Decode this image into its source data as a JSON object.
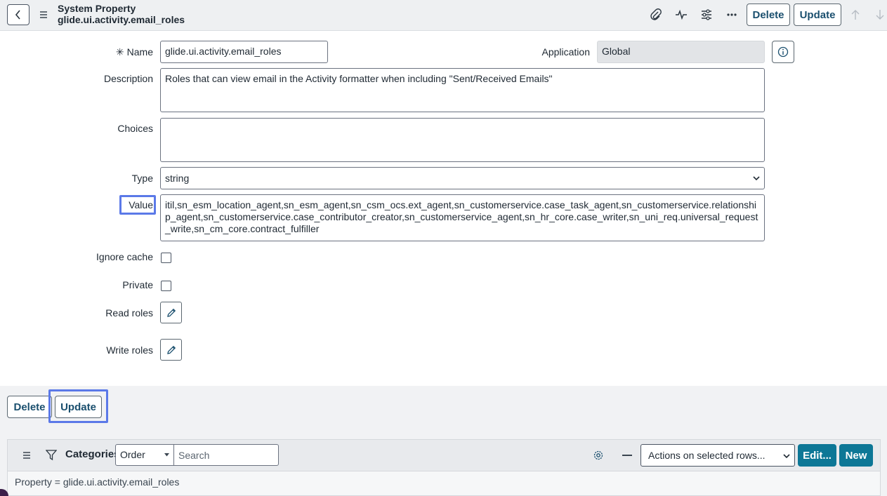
{
  "header": {
    "title": "System Property",
    "subtitle": "glide.ui.activity.email_roles",
    "delete_label": "Delete",
    "update_label": "Update",
    "icons": [
      "back-icon",
      "menu-icon",
      "paperclip-icon",
      "activity-icon",
      "settings-sliders-icon",
      "more-icon",
      "arrow-up-icon",
      "arrow-down-icon"
    ]
  },
  "form": {
    "name": {
      "label": "Name",
      "required_mark": "✳",
      "value": "glide.ui.activity.email_roles"
    },
    "application": {
      "label": "Application",
      "value": "Global"
    },
    "description": {
      "label": "Description",
      "value": "Roles that can view email in the Activity formatter when including \"Sent/Received Emails\""
    },
    "choices": {
      "label": "Choices",
      "value": ""
    },
    "type": {
      "label": "Type",
      "value": "string"
    },
    "value": {
      "label": "Value",
      "value": "itil,sn_esm_location_agent,sn_esm_agent,sn_csm_ocs.ext_agent,sn_customerservice.case_task_agent,sn_customerservice.relationship_agent,sn_customerservice.case_contributor_creator,sn_customerservice_agent,sn_hr_core.case_writer,sn_uni_req.universal_request_write,sn_cm_core.contract_fulfiller"
    },
    "ignore_cache": {
      "label": "Ignore cache",
      "checked": false
    },
    "private": {
      "label": "Private",
      "checked": false
    },
    "read_roles": {
      "label": "Read roles"
    },
    "write_roles": {
      "label": "Write roles"
    }
  },
  "footer": {
    "delete_label": "Delete",
    "update_label": "Update"
  },
  "related_list": {
    "title": "Categories",
    "order_select": "Order",
    "search_placeholder": "Search",
    "actions_select": "Actions on selected rows...",
    "edit_label": "Edit...",
    "new_label": "New",
    "filter_text": "Property = glide.ui.activity.email_roles"
  },
  "colors": {
    "accent": "#0d7796",
    "highlight": "#5b79e8",
    "header_bg": "#eef0f2"
  }
}
